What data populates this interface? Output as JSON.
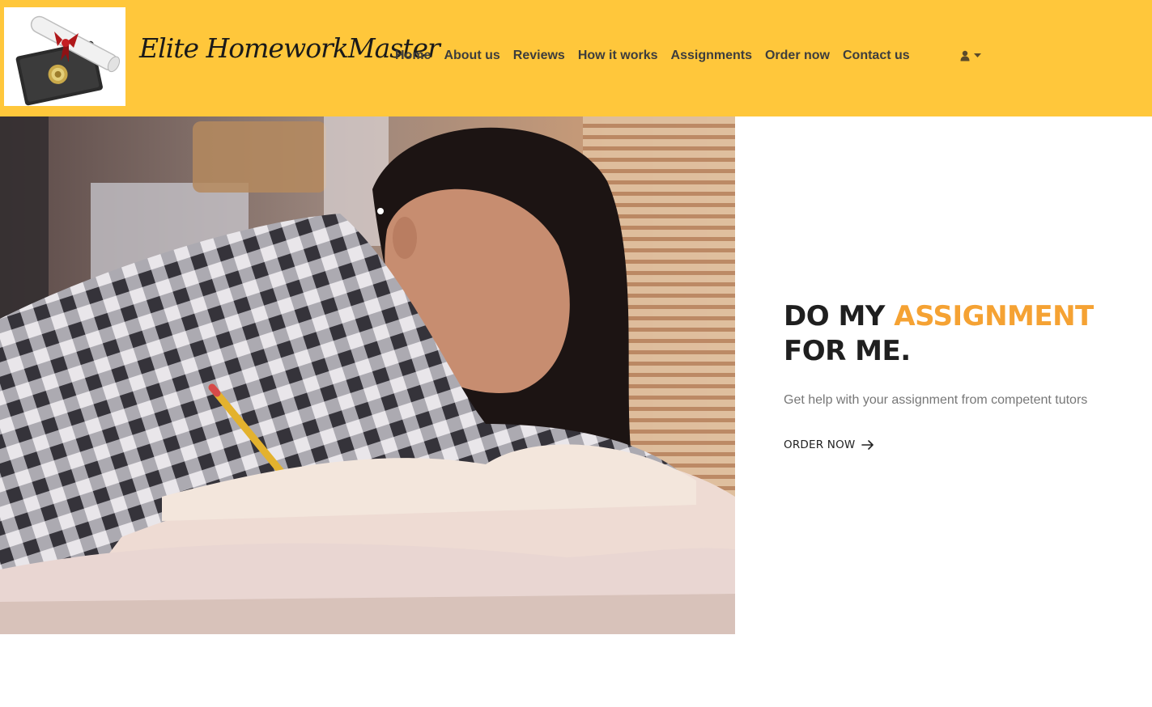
{
  "header": {
    "brand_name": "Elite HomeworkMaster",
    "background_color": "#ffc73b",
    "logo_icon": "diploma-logo"
  },
  "nav": {
    "items": [
      {
        "label": "Home"
      },
      {
        "label": "About us"
      },
      {
        "label": "Reviews"
      },
      {
        "label": "How it works"
      },
      {
        "label": "Assignments"
      },
      {
        "label": "Order now"
      },
      {
        "label": "Contact us"
      }
    ],
    "user_menu_icon": "user-icon",
    "dropdown_icon": "caret-down-icon"
  },
  "hero": {
    "title_part1": "DO MY ",
    "title_accent": "ASSIGNMENT",
    "title_part2": "FOR ME.",
    "accent_color": "#f5a233",
    "subtitle": "Get help with your assignment from competent tutors",
    "cta_label": "ORDER NOW",
    "cta_icon": "arrow-right-icon",
    "image_subject": "student-writing-photo"
  }
}
